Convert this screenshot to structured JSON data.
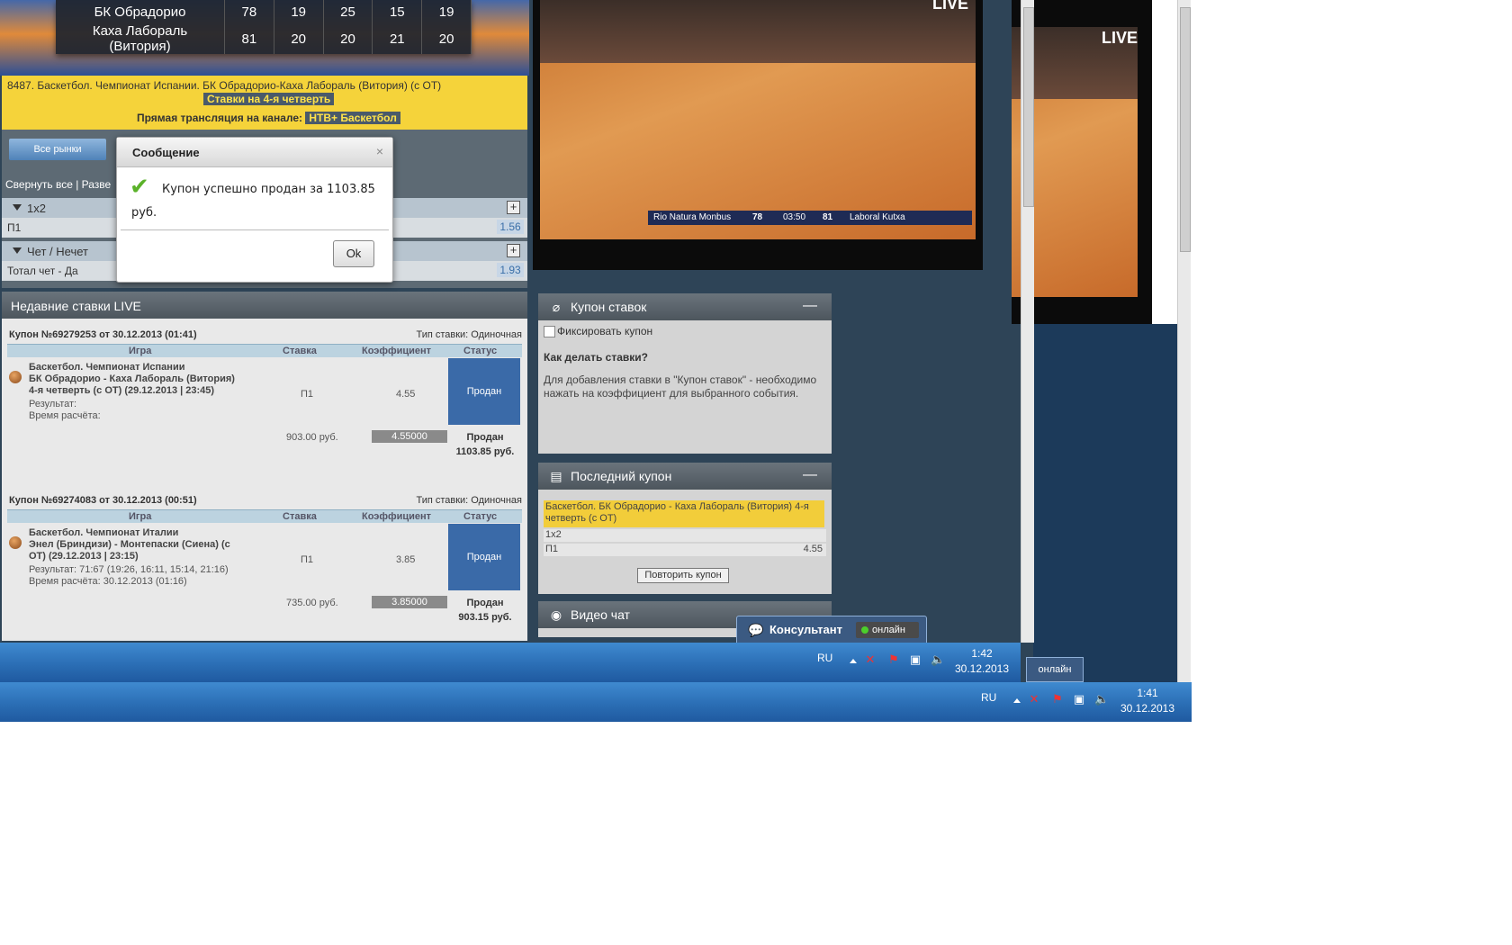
{
  "scoreboard": {
    "rows": [
      {
        "team": "БК Обрадорио",
        "total": "78",
        "q1": "19",
        "q2": "25",
        "q3": "15",
        "q4": "19"
      },
      {
        "team": "Каха Лабораль (Витория)",
        "total": "81",
        "q1": "20",
        "q2": "20",
        "q3": "21",
        "q4": "20"
      }
    ]
  },
  "match_info": {
    "title": "8487. Баскетбол. Чемпионат Испании. БК Обрадорио-Каха Лабораль (Витория) (с ОТ)",
    "quarter_badge": "Ставки на 4-я четверть",
    "channel_label": "Прямая трансляция на канале:",
    "channel_name": "НТВ+ Баскетбол"
  },
  "markets": {
    "all_markets_button": "Все рынки",
    "collapse_links": "Свернуть все | Разве",
    "groups": [
      {
        "title": "1х2",
        "item": "П1",
        "odd": "1.56"
      },
      {
        "title": "Чет / Нечет",
        "item": "Тотал чет - Да",
        "odd": "1.93"
      }
    ]
  },
  "dialog": {
    "title": "Сообщение",
    "close": "×",
    "message": "Купон успешно продан за 1103.85 руб.",
    "ok": "Ok"
  },
  "recent_bets": {
    "header": "Недавние ставки LIVE",
    "columns": {
      "game": "Игра",
      "stake": "Ставка",
      "coef": "Коэффициент",
      "status": "Статус"
    },
    "coupons": [
      {
        "id": "Купон №69279253 от 30.12.2013 (01:41)",
        "type": "Тип ставки: Одиночная",
        "line1": "Баскетбол. Чемпионат Испании",
        "line2": "БК Обрадорио - Каха Лабораль (Витория)",
        "line3": "4-я четверть (с ОТ) (29.12.2013 | 23:45)",
        "result": "Результат:",
        "calc_time": "Время расчёта:",
        "pick": "П1",
        "coef": "4.55",
        "status": "Продан",
        "sum": "903.00 руб.",
        "coef_total": "4.55000",
        "sold": "Продан",
        "sold_amount": "1103.85 руб."
      },
      {
        "id": "Купон №69274083 от 30.12.2013 (00:51)",
        "type": "Тип ставки: Одиночная",
        "line1": "Баскетбол. Чемпионат Италии",
        "line2": "Энел (Бриндизи) - Монтепаски (Сиена) (с",
        "line3": "ОТ) (29.12.2013 | 23:15)",
        "result": "Результат: 71:67 (19:26, 16:11, 15:14, 21:16)",
        "calc_time": "Время расчёта: 30.12.2013 (01:16)",
        "pick": "П1",
        "coef": "3.85",
        "status": "Продан",
        "sum": "735.00 руб.",
        "coef_total": "3.85000",
        "sold": "Продан",
        "sold_amount": "903.15 руб."
      }
    ]
  },
  "video": {
    "live_label": "LIVE",
    "scorebug": {
      "home": "Rio Natura Monbus",
      "home_score": "78",
      "clock": "03:50",
      "away_score": "81",
      "away": "Laboral Kutxa"
    }
  },
  "coupon_panel": {
    "title": "Купон ставок",
    "minimize": "—",
    "fix_label": "Фиксировать купон",
    "howto_title": "Как делать ставки?",
    "howto_text": "Для добавления ставки в \"Купон ставок\" - необходимо нажать на коэффициент для выбранного события."
  },
  "last_coupon": {
    "title": "Последний купон",
    "minimize": "—",
    "event": "Баскетбол. БК Обрадорио - Каха Лабораль (Витория) 4-я четверть (с ОТ)",
    "market": "1х2",
    "pick": "П1",
    "odd": "4.55",
    "repeat_button": "Повторить купон"
  },
  "video_chat": {
    "title": "Видео чат"
  },
  "consultant": {
    "label": "Консультант",
    "status": "онлайн"
  },
  "taskbar1": {
    "lang": "RU",
    "time": "1:42",
    "date": "30.12.2013"
  },
  "taskbar2": {
    "lang": "RU",
    "time": "1:41",
    "date": "30.12.2013"
  }
}
